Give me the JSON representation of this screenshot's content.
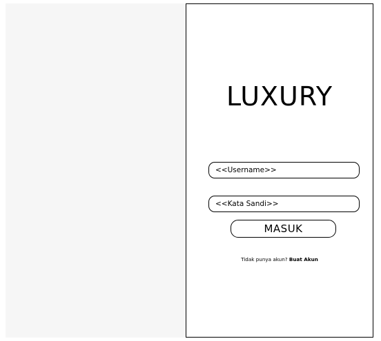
{
  "app": {
    "title": "LUXURY"
  },
  "login_form": {
    "username_placeholder": "<<Username>>",
    "password_placeholder": "<<Kata Sandi>>",
    "submit_label": "MASUK"
  },
  "signup": {
    "prompt": "Tidak punya akun? ",
    "link_label": "Buat Akun"
  },
  "colors": {
    "left_pane_background": "#f6f6f6",
    "frame_border": "#000000",
    "text": "#000000"
  }
}
